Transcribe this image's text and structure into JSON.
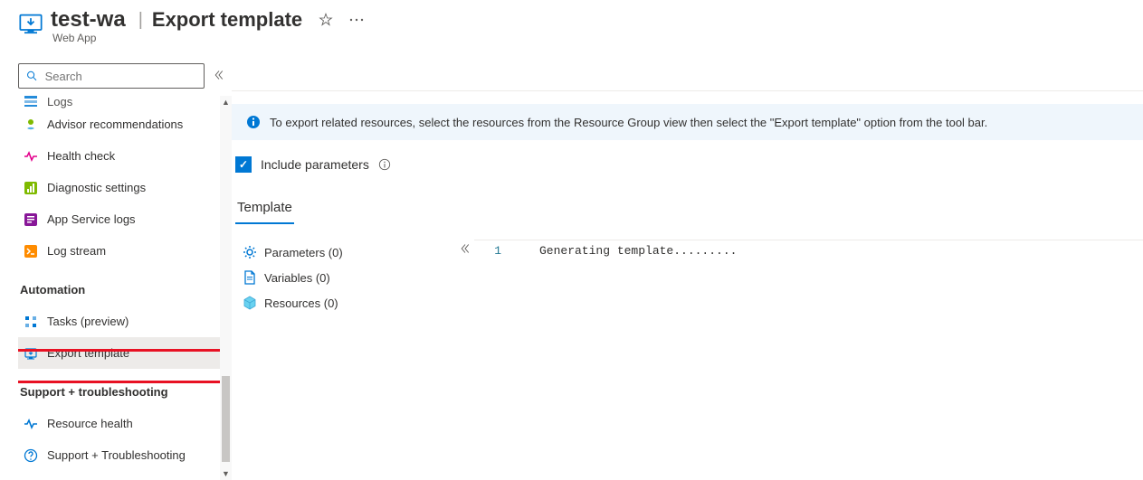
{
  "header": {
    "resource_name": "test-wa",
    "page_title": "Export template",
    "subtitle": "Web App"
  },
  "search": {
    "placeholder": "Search"
  },
  "sidebar": {
    "items_top": [
      {
        "label": "Logs",
        "icon": "logs"
      },
      {
        "label": "Advisor recommendations",
        "icon": "advisor"
      },
      {
        "label": "Health check",
        "icon": "health"
      },
      {
        "label": "Diagnostic settings",
        "icon": "diag"
      },
      {
        "label": "App Service logs",
        "icon": "applogs"
      },
      {
        "label": "Log stream",
        "icon": "stream"
      }
    ],
    "section_automation": "Automation",
    "items_automation": [
      {
        "label": "Tasks (preview)",
        "icon": "tasks"
      },
      {
        "label": "Export template",
        "icon": "export",
        "selected": true
      }
    ],
    "section_support": "Support + troubleshooting",
    "items_support": [
      {
        "label": "Resource health",
        "icon": "reshealth"
      },
      {
        "label": "Support + Troubleshooting",
        "icon": "support"
      }
    ]
  },
  "main": {
    "info_text": "To export related resources, select the resources from the Resource Group view then select the \"Export template\" option from the tool bar.",
    "checkbox_label": "Include parameters",
    "tab_template": "Template",
    "tree": {
      "parameters": "Parameters (0)",
      "variables": "Variables (0)",
      "resources": "Resources (0)"
    },
    "editor": {
      "line1_num": "1",
      "line1_text": "Generating template........."
    }
  }
}
